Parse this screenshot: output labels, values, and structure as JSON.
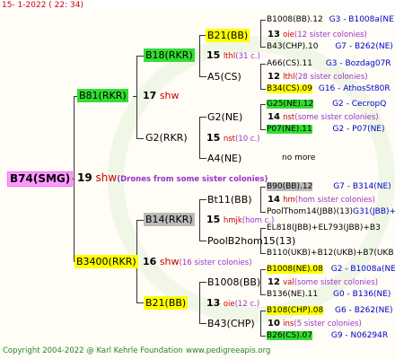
{
  "header": {
    "text": "15-   1-2022 (  22: 34)"
  },
  "footer": {
    "copyright": "Copyright 2004-2022 @ Karl Kehrle Foundation",
    "site": "www.pedigreeapis.org"
  },
  "root": {
    "name": "B74(SMG)",
    "num": "19",
    "code": "shw",
    "note": "(Drones from some sister colonies)"
  },
  "sire": {
    "name": "B81(RKR)",
    "num": "17",
    "code": "shw"
  },
  "dam": {
    "name": "B3400(RKR)",
    "num": "16",
    "code": "shw",
    "note": "(16 sister colonies)"
  },
  "ss": {
    "name": "B18(RKR)",
    "num": "15",
    "code": "lthl",
    "note": "(31 c.)"
  },
  "sd": {
    "name": "G2(RKR)",
    "num": "15",
    "code": "nst",
    "note": "(10 c.)"
  },
  "ds": {
    "name": "B14(RKR)",
    "num": "15",
    "code": "hmjk",
    "note": "(hom c.)"
  },
  "dd": {
    "name": "B21(BB)",
    "num": "13",
    "code": "oie",
    "note": "(12 c.)"
  },
  "sss": {
    "name": "B21(BB)",
    "num": "13",
    "code": "oie",
    "note": "(12 sister colonies)"
  },
  "ssd": {
    "name": "A5(CS)",
    "num": "12",
    "code": "lthl",
    "note": "(28 sister colonies)"
  },
  "sds": {
    "name": "G2(NE)",
    "num": "14",
    "code": "nst",
    "note": "(some sister colonies)"
  },
  "sdd": {
    "name": "A4(NE)",
    "none": "no more"
  },
  "dss": {
    "name": "Bt11(BB)",
    "num": "14",
    "code": "hm",
    "note": "(hom sister colonies)"
  },
  "dsd": {
    "name": "PoolB2hom15(13)"
  },
  "dds": {
    "name": "B1008(BB)",
    "num": "12",
    "code": "val",
    "note": "(some sister colonies)"
  },
  "ddd": {
    "name": "B43(CHP)",
    "num": "10",
    "code": "ins",
    "note": "(5 sister colonies)"
  },
  "right": [
    {
      "name": "B1008(BB).12",
      "ref": "G3 - B1008a(NE)"
    },
    {
      "name": "B43(CHP).10",
      "ref": "G7 - B262(NE)"
    },
    {
      "name": "A66(CS).11",
      "ref": "G3 - Bozdag07R"
    },
    {
      "name": "B34(CS).09",
      "ref": "G16 - AthosSt80R"
    },
    {
      "name": "G25(NE).12",
      "ref": "G2 - CecropQ"
    },
    {
      "name": "P07(NE).11",
      "ref": "G2 - P07(NE)"
    },
    {
      "name": "B90(BB).12",
      "ref": "G7 - B314(NE)"
    },
    {
      "name": "PoolThom14(JBB)(13)",
      "ref": "G31(JBB)+B"
    },
    {
      "name": "EL818(JBB)+EL793(JBB)+B3",
      "ref": ""
    },
    {
      "name": "B110(UKB)+B12(UKB)+B7(UKB",
      "ref": ""
    },
    {
      "name": "B1008(NE).08",
      "ref": "G2 - B1008a(NE)"
    },
    {
      "name": "B136(NE).11",
      "ref": "G0 - B136(NE)"
    },
    {
      "name": "B108(CHP).08",
      "ref": "G6 - B262(NE)"
    },
    {
      "name": "B26(CS).07",
      "ref": "G9 - N06294R"
    }
  ]
}
